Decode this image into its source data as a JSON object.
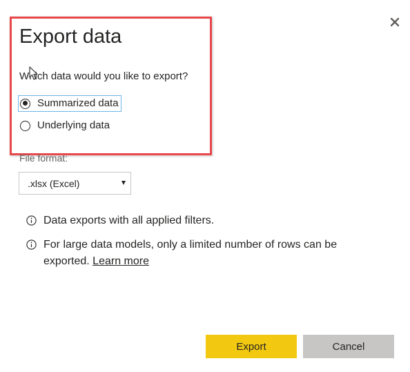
{
  "dialog": {
    "title": "Export data",
    "question": "Which data would you like to export?",
    "options": [
      {
        "label": "Summarized data",
        "selected": true
      },
      {
        "label": "Underlying data",
        "selected": false
      }
    ],
    "file_format": {
      "label": "File format:",
      "selected": ".xlsx (Excel)"
    },
    "info": [
      {
        "text": "Data exports with all applied filters.",
        "icon": "info-icon"
      },
      {
        "text": "For large data models, only a limited number of rows can be exported.",
        "link": "Learn more",
        "icon": "info-icon"
      }
    ],
    "buttons": {
      "export": "Export",
      "cancel": "Cancel"
    },
    "close_icon": "close-icon"
  },
  "colors": {
    "accent": "#f2c811",
    "secondary_button": "#c8c6c4",
    "highlight_border": "#e8474c",
    "focus_outline": "#6fb4e8",
    "text": "#252423"
  }
}
